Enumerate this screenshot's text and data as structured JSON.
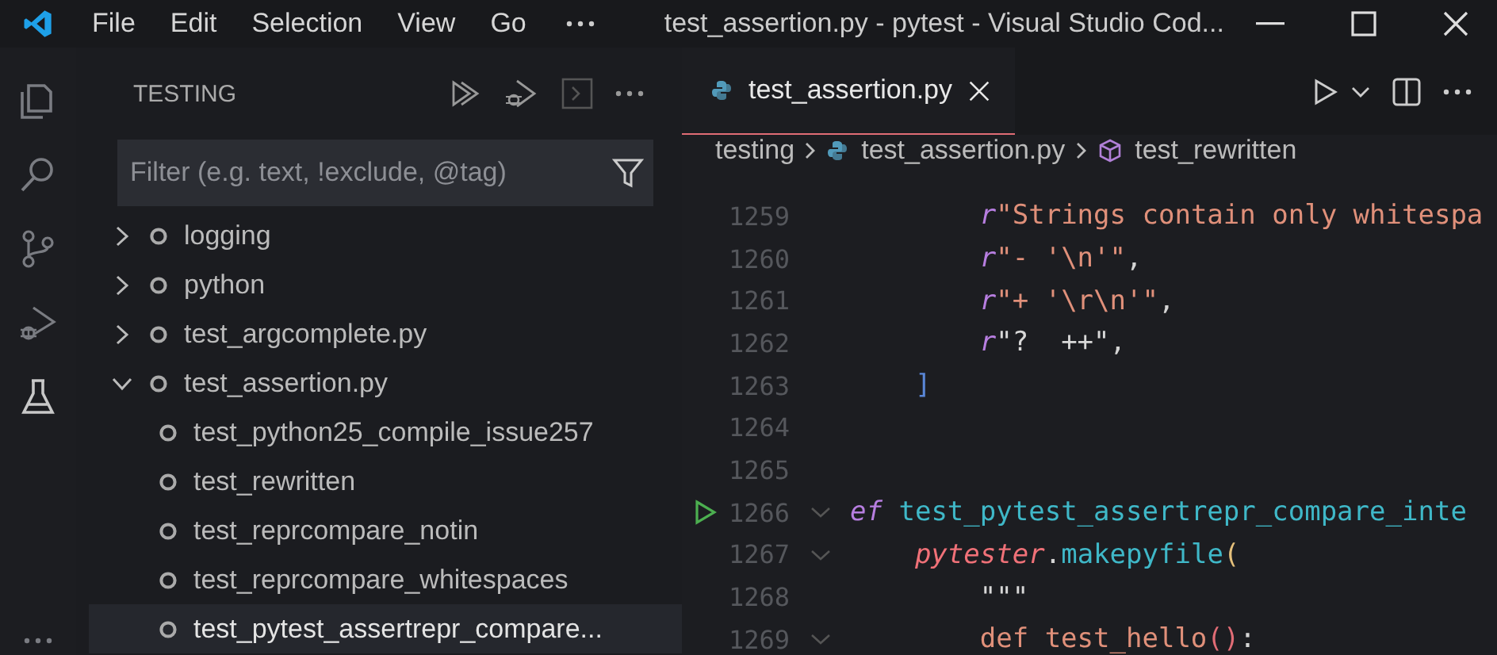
{
  "title_bar": {
    "menu": [
      "File",
      "Edit",
      "Selection",
      "View",
      "Go"
    ],
    "title": "test_assertion.py - pytest - Visual Studio Cod..."
  },
  "activity_bar": {
    "items": [
      {
        "kind": "explorer",
        "selected": false
      },
      {
        "kind": "search",
        "selected": false
      },
      {
        "kind": "source-control",
        "selected": false
      },
      {
        "kind": "run-debug",
        "selected": false
      },
      {
        "kind": "testing",
        "selected": true
      }
    ]
  },
  "sidebar": {
    "title": "TESTING",
    "filter": {
      "placeholder": "Filter (e.g. text, !exclude, @tag)"
    },
    "tree": [
      {
        "label": "logging",
        "expanded": false,
        "selected": false
      },
      {
        "label": "python",
        "expanded": false,
        "selected": false
      },
      {
        "label": "test_argcomplete.py",
        "expanded": false,
        "selected": false
      },
      {
        "label": "test_assertion.py",
        "expanded": true,
        "selected": false,
        "children": [
          {
            "label": "test_python25_compile_issue257",
            "selected": false
          },
          {
            "label": "test_rewritten",
            "selected": false
          },
          {
            "label": "test_reprcompare_notin",
            "selected": false
          },
          {
            "label": "test_reprcompare_whitespaces",
            "selected": false
          },
          {
            "label": "test_pytest_assertrepr_compare...",
            "selected": true
          }
        ]
      }
    ]
  },
  "editor": {
    "tab": {
      "label": "test_assertion.py",
      "selected": true
    },
    "breadcrumbs": [
      {
        "kind": "folder",
        "label": "testing"
      },
      {
        "kind": "python-file",
        "label": "test_assertion.py"
      },
      {
        "kind": "symbol",
        "label": "test_rewritten"
      }
    ],
    "lines": [
      {
        "number": "1259",
        "run": false,
        "fold": false,
        "tokens": [
          {
            "kind": "prefix",
            "text": "        r"
          },
          {
            "kind": "string",
            "text": "\"Strings contain only whitespa"
          }
        ]
      },
      {
        "number": "1260",
        "run": false,
        "fold": false,
        "tokens": [
          {
            "kind": "prefix",
            "text": "        r"
          },
          {
            "kind": "string",
            "text": "\"- '\\n'\""
          },
          {
            "kind": "plain",
            "text": ","
          }
        ]
      },
      {
        "number": "1261",
        "run": false,
        "fold": false,
        "tokens": [
          {
            "kind": "prefix",
            "text": "        r"
          },
          {
            "kind": "string",
            "text": "\"+ '\\r\\n'\""
          },
          {
            "kind": "plain",
            "text": ","
          }
        ]
      },
      {
        "number": "1262",
        "run": false,
        "fold": false,
        "tokens": [
          {
            "kind": "prefix",
            "text": "        r"
          },
          {
            "kind": "docstring",
            "text": "\"?  ++\""
          },
          {
            "kind": "plain",
            "text": ","
          }
        ]
      },
      {
        "number": "1263",
        "run": false,
        "fold": false,
        "tokens": [
          {
            "kind": "bracket",
            "text": "    ]"
          }
        ]
      },
      {
        "number": "1264",
        "run": false,
        "fold": false
      },
      {
        "number": "1265",
        "run": false,
        "fold": false
      },
      {
        "number": "1266",
        "run": true,
        "fold": true,
        "tokens": [
          {
            "kind": "keyword",
            "text": "ef"
          },
          {
            "kind": "function",
            "text": " test_pytest_assertrepr_compare_inte"
          }
        ]
      },
      {
        "number": "1267",
        "run": false,
        "fold": true,
        "tokens": [
          {
            "kind": "variable",
            "text": "    pytester"
          },
          {
            "kind": "plain",
            "text": "."
          },
          {
            "kind": "function",
            "text": "makepyfile"
          },
          {
            "kind": "paren",
            "text": "("
          }
        ]
      },
      {
        "number": "1268",
        "run": false,
        "fold": false,
        "tokens": [
          {
            "kind": "docstring",
            "text": "        \"\"\""
          }
        ]
      },
      {
        "number": "1269",
        "run": false,
        "fold": true,
        "tokens": [
          {
            "kind": "string",
            "text": "        def test_hello"
          },
          {
            "kind": "paren2",
            "text": "()"
          },
          {
            "kind": "plain",
            "text": ":"
          }
        ]
      }
    ]
  }
}
